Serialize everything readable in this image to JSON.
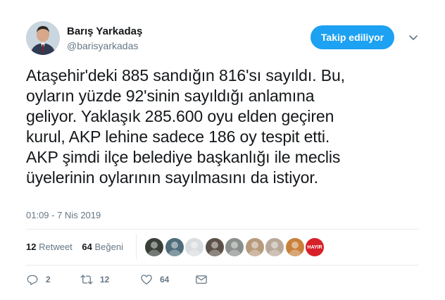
{
  "author": {
    "name": "Barış Yarkadaş",
    "handle": "@barisyarkadas"
  },
  "follow_button": {
    "label": "Takip ediliyor",
    "color": "#1da1f2"
  },
  "tweet": {
    "text": "Ataşehir'deki 885 sandığın 816'sı sayıldı. Bu,\noyların yüzde 92'sinin sayıldığı anlamına\ngeliyor. Yaklaşık 285.600 oyu elden geçiren\nkurul, AKP lehine sadece 186 oy tespit etti.\nAKP şimdi ilçe belediye başkanlığı ile meclis\nüyelerinin oylarının  sayılmasını da istiyor.",
    "timestamp": "01:09 - 7 Nis 2019"
  },
  "stats": {
    "retweets": {
      "count": "12",
      "label": "Retweet"
    },
    "likes": {
      "count": "64",
      "label": "Beğeni"
    }
  },
  "likers": [
    {
      "icon": "user-avatar-icon",
      "color": "#3a3f38"
    },
    {
      "icon": "user-avatar-icon",
      "color": "#4f6d7a"
    },
    {
      "icon": "user-avatar-icon",
      "color": "#d9dde0"
    },
    {
      "icon": "user-avatar-icon",
      "color": "#5c5148"
    },
    {
      "icon": "user-avatar-icon",
      "color": "#8a8f8c"
    },
    {
      "icon": "user-avatar-icon",
      "color": "#b79a7c"
    },
    {
      "icon": "user-avatar-icon",
      "color": "#b9a89a"
    },
    {
      "icon": "user-avatar-icon",
      "color": "#c9803b"
    },
    {
      "icon": "hayir-badge-icon",
      "color": "#d6212a",
      "text": "HAYIR"
    }
  ],
  "actions": {
    "reply": {
      "icon": "reply-icon",
      "count": "2"
    },
    "retweet": {
      "icon": "retweet-icon",
      "count": "12"
    },
    "like": {
      "icon": "heart-icon",
      "count": "64"
    },
    "dm": {
      "icon": "envelope-icon"
    }
  },
  "colors": {
    "accent": "#1da1f2",
    "secondary_text": "#657786",
    "border": "#e6ecf0"
  }
}
